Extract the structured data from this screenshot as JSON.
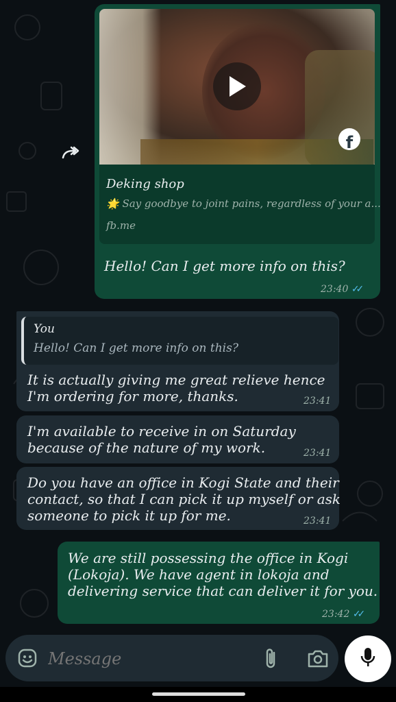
{
  "messages": {
    "link_preview": {
      "title": "Deking shop",
      "description": "🌟 Say goodbye to joint pains, regardless of your a...",
      "url": "fb.me"
    },
    "out1": {
      "text": "Hello! Can I get more info on this?",
      "time": "23:40"
    },
    "quote": {
      "author": "You",
      "text": "Hello! Can I get more info on this?"
    },
    "in1": {
      "lines": [
        "It is actually giving me great relieve hence",
        "I'm ordering for more, thanks."
      ],
      "time": "23:41"
    },
    "in2": {
      "lines": [
        "I'm available to receive in on Saturday",
        "because of the nature of my work."
      ],
      "time": "23:41"
    },
    "in3": {
      "lines": [
        "Do you have an office in Kogi State and their",
        "contact, so that I can pick it up myself or ask",
        "someone to pick it up for me."
      ],
      "time": "23:41"
    },
    "out2": {
      "lines": [
        "We are still possessing the office in Kogi",
        "(Lokoja). We have agent in lokoja and",
        "delivering service that can deliver it for you."
      ],
      "time": "23:42"
    }
  },
  "composer": {
    "placeholder": "Message"
  },
  "icons": {
    "forward": "forward-icon",
    "play": "play-icon",
    "facebook": "facebook-icon",
    "emoji": "emoji-icon",
    "attach": "paperclip-icon",
    "camera": "camera-icon",
    "mic": "microphone-icon",
    "read_receipt": "double-check-icon"
  },
  "colors": {
    "outgoing_bubble": "#0f4a37",
    "incoming_bubble": "#1f2b33",
    "read_tick": "#53bdeb",
    "background": "#0b1014"
  }
}
